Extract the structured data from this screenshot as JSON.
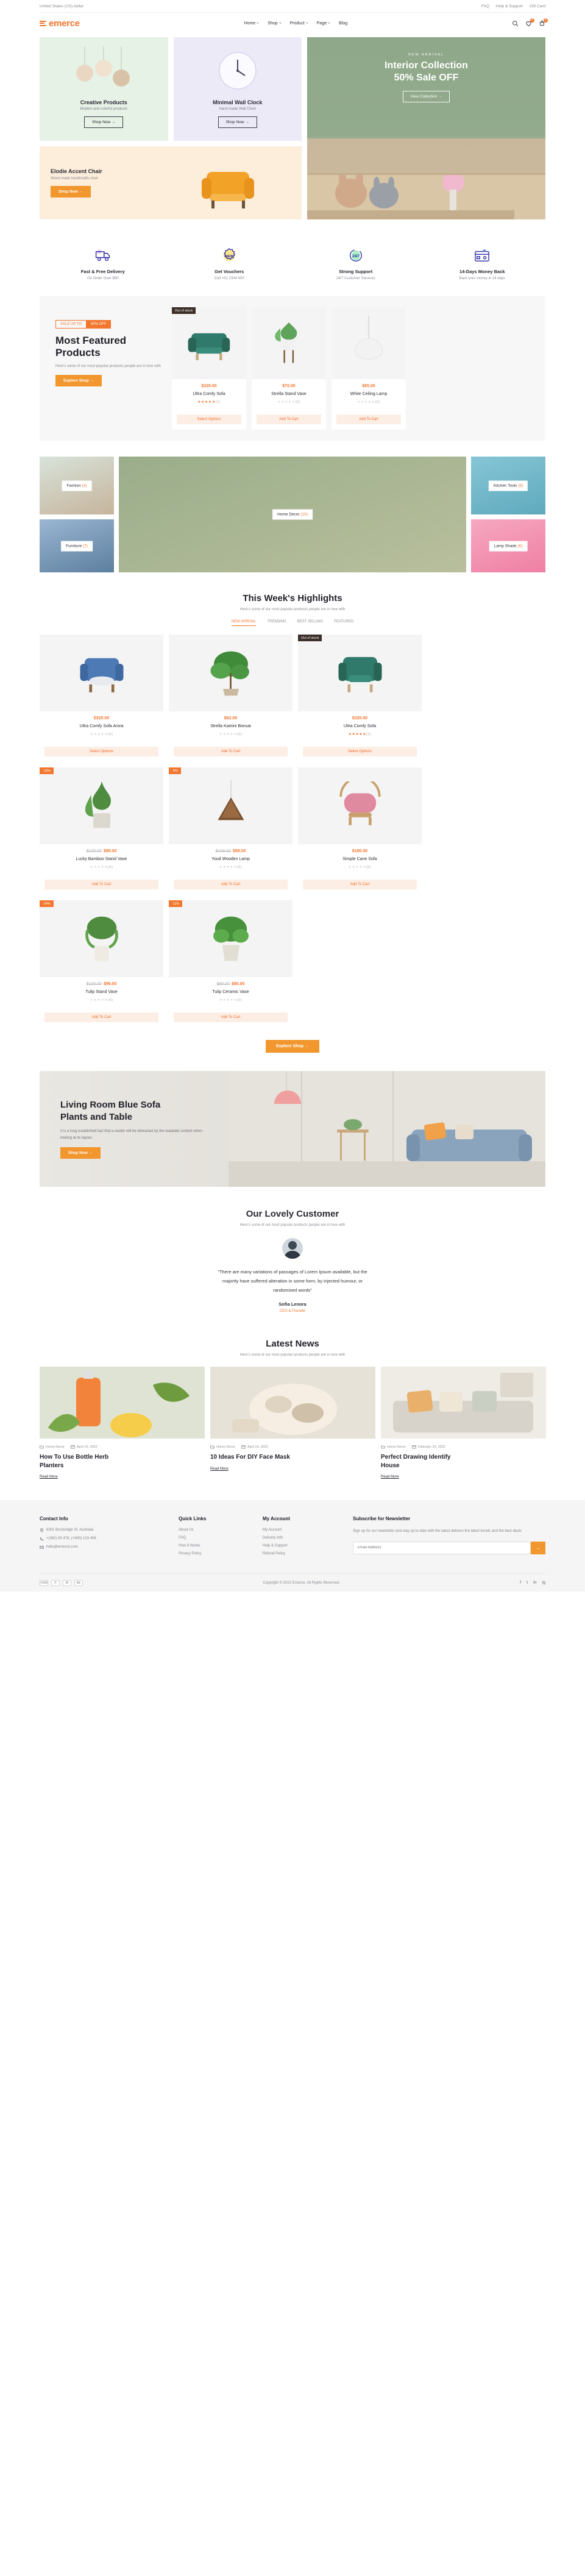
{
  "topbar": {
    "currency": "United States (US) dollar",
    "links": [
      "FAQ",
      "Help & Support",
      "Gift Card"
    ]
  },
  "header": {
    "logo": "emerce",
    "nav": [
      {
        "label": "Home",
        "caret": true
      },
      {
        "label": "Shop",
        "caret": true
      },
      {
        "label": "Product",
        "caret": true
      },
      {
        "label": "Page",
        "caret": true
      },
      {
        "label": "Blog",
        "caret": false
      }
    ],
    "icons": [
      {
        "name": "search-icon",
        "badge": ""
      },
      {
        "name": "wishlist-icon",
        "badge": "0"
      },
      {
        "name": "cart-icon",
        "badge": "0"
      }
    ]
  },
  "hero": {
    "promos": [
      {
        "title": "Creative Products",
        "subtitle": "Modern and colorful products",
        "button": "Shop Now →"
      },
      {
        "title": "Minimal Wall Clock",
        "subtitle": "Hand made Wall Clock",
        "button": "Shop Now →"
      }
    ],
    "wide": {
      "title": "Elodie Accent Chair",
      "subtitle": "Wood made handicrafts chair",
      "button": "Shop Now →"
    },
    "main": {
      "eyebrow": "NEW ARRIVAL",
      "title_line1": "Interior Collection",
      "title_line2": "50% Sale OFF",
      "button": "View Collection →"
    }
  },
  "services": [
    {
      "icon": "delivery-truck-icon",
      "title": "Fast & Free Delivery",
      "subtitle": "On Order Over $90"
    },
    {
      "icon": "voucher-badge-icon",
      "title": "Get Vouchers",
      "subtitle": "Call +01 2334 600"
    },
    {
      "icon": "support-247-icon",
      "title": "Strong Support",
      "subtitle": "24/7 Customer Services"
    },
    {
      "icon": "money-back-card-icon",
      "title": "14-Days Money Back",
      "subtitle": "Back your money in 14 days"
    }
  ],
  "featured": {
    "badge_left": "SALE UP TO",
    "badge_right": "50% OFF",
    "title_line1": "Most Featured",
    "title_line2": "Products",
    "description": "Here's some of our most popular products people are in love with",
    "button": "Explore Shop →",
    "products": [
      {
        "tag": "Out of stock",
        "tag_type": "oos",
        "price": "$320.00",
        "old_price": "",
        "name": "Ultra Comfy Sofa",
        "rating": 5,
        "reviews": "(1)",
        "action": "Select Options"
      },
      {
        "tag": "",
        "tag_type": "",
        "price": "$70.00",
        "old_price": "",
        "name": "Strella Stand Vase",
        "rating": 0,
        "reviews": "(0)",
        "action": "Add To Cart"
      },
      {
        "tag": "",
        "tag_type": "",
        "price": "$65.00",
        "old_price": "",
        "name": "White Ceiling Lamp",
        "rating": 0,
        "reviews": "(0)",
        "action": "Add To Cart"
      }
    ]
  },
  "categories": [
    {
      "name": "Fashion",
      "count": "(4)"
    },
    {
      "name": "Furniture",
      "count": "(7)"
    },
    {
      "name": "Home Decor",
      "count": "(10)"
    },
    {
      "name": "Kitchen Tools",
      "count": "(9)"
    },
    {
      "name": "Lamp Shade",
      "count": "(6)"
    }
  ],
  "highlights": {
    "title": "This Week's Highlights",
    "subtitle": "Here's some of our most popular products people are in love with",
    "tabs": [
      "NEW ARRIVAL",
      "TRENDING",
      "BEST SELLING",
      "FEATURED"
    ],
    "active_tab": "NEW ARRIVAL",
    "button": "Explore Shop →",
    "products": [
      {
        "tag": "",
        "tag_type": "",
        "price": "$325.00",
        "old_price": "",
        "name": "Ultra Comfy Sofa Arora",
        "rating": 0,
        "reviews": "(0)",
        "action": "Select Options"
      },
      {
        "tag": "",
        "tag_type": "",
        "price": "$62.00",
        "old_price": "",
        "name": "Strella Kamini Bonsai",
        "rating": 0,
        "reviews": "(0)",
        "action": "Add To Cart"
      },
      {
        "tag": "Out of stock",
        "tag_type": "oos",
        "price": "$320.00",
        "old_price": "",
        "name": "Ultra Comfy Sofa",
        "rating": 5,
        "reviews": "(1)",
        "action": "Select Options"
      },
      {
        "tag": "-18%",
        "tag_type": "sale",
        "price": "$99.00",
        "old_price": "$120.00",
        "name": "Lucky Bamboo Stand Vase",
        "rating": 0,
        "reviews": "(0)",
        "action": "Add To Cart"
      },
      {
        "tag": "-9%",
        "tag_type": "sale",
        "price": "$99.00",
        "old_price": "$109.00",
        "name": "Youd Wooden Lamp",
        "rating": 0,
        "reviews": "(0)",
        "action": "Add To Cart"
      },
      {
        "tag": "",
        "tag_type": "",
        "price": "$180.00",
        "old_price": "",
        "name": "Simple Cane Sofa",
        "rating": 0,
        "reviews": "(0)",
        "action": "Add To Cart"
      },
      {
        "tag": "-24%",
        "tag_type": "sale",
        "price": "$99.00",
        "old_price": "$130.00",
        "name": "Tulip Stand Vase",
        "rating": 0,
        "reviews": "(0)",
        "action": "Add To Cart"
      },
      {
        "tag": "-11%",
        "tag_type": "sale",
        "price": "$80.00",
        "old_price": "$90.00",
        "name": "Tulip Ceramic Vase",
        "rating": 0,
        "reviews": "(0)",
        "action": "Add To Cart"
      }
    ]
  },
  "banner": {
    "title_line1": "Living Room Blue Sofa",
    "title_line2": "Plants and Table",
    "description": "It is a long established fact that a reader will be distracted by the readable content when looking at its layout.",
    "button": "Shop Now →"
  },
  "testimonial": {
    "title": "Our Lovely Customer",
    "subtitle": "Here's some of our most popular products people are in love with",
    "quote_line1": "“There are many variations of passages of Lorem Ipsum available, but the",
    "quote_line2": "majority have suffered alteration in some form, by injected humour, or",
    "quote_line3": "randomised words”",
    "name": "Sofia Lenora",
    "role": "CEO & Founder"
  },
  "news": {
    "title": "Latest News",
    "subtitle": "Here's some of our most popular products people are in love with",
    "posts": [
      {
        "category": "Home Decor",
        "date": "April 19, 2022",
        "title_line1": "How To Use Bottle Herb",
        "title_line2": "Planters",
        "link": "Read More"
      },
      {
        "category": "Home Decor",
        "date": "April 19, 2022",
        "title_line1": "10 Ideas For DIY Face Mask",
        "title_line2": "",
        "link": "Read More"
      },
      {
        "category": "Home Decor",
        "date": "February 20, 2022",
        "title_line1": "Perfect Drawing Identify",
        "title_line2": "House",
        "link": "Read More"
      }
    ]
  },
  "footer": {
    "contact": {
      "title": "Contact Info",
      "items": [
        {
          "icon": "location-icon",
          "text": "6301 Brockridge St, Australia"
        },
        {
          "icon": "phone-icon",
          "text": "+(082) 65 478, (+800) 123 456"
        },
        {
          "icon": "mail-icon",
          "text": "hello@emerce.com"
        }
      ]
    },
    "quick_links": {
      "title": "Quick Links",
      "items": [
        "About Us",
        "FAQ",
        "How It Works",
        "Privacy Policy"
      ]
    },
    "account": {
      "title": "My Account",
      "items": [
        "My Account",
        "Delivery Info",
        "Help & Support",
        "Refund Policy"
      ]
    },
    "newsletter": {
      "title": "Subscribe for Newsletter",
      "description": "Sign up for our newsletter and stay up to date with the latest delivers the latest trends and the best deals",
      "placeholder": "Email Address",
      "button": "→"
    },
    "payments": [
      "VISA",
      "P",
      "M",
      "AE"
    ],
    "copyright": "Copyright © 2022 Emerce. All Rights Reserved.",
    "social": [
      "f",
      "t",
      "in",
      "ig"
    ]
  },
  "colors": {
    "accent": "#f2762e",
    "accent_soft": "#fdeee5",
    "orange_button": "#f2962e",
    "text": "#2b2b35",
    "muted": "#8e8e97"
  }
}
